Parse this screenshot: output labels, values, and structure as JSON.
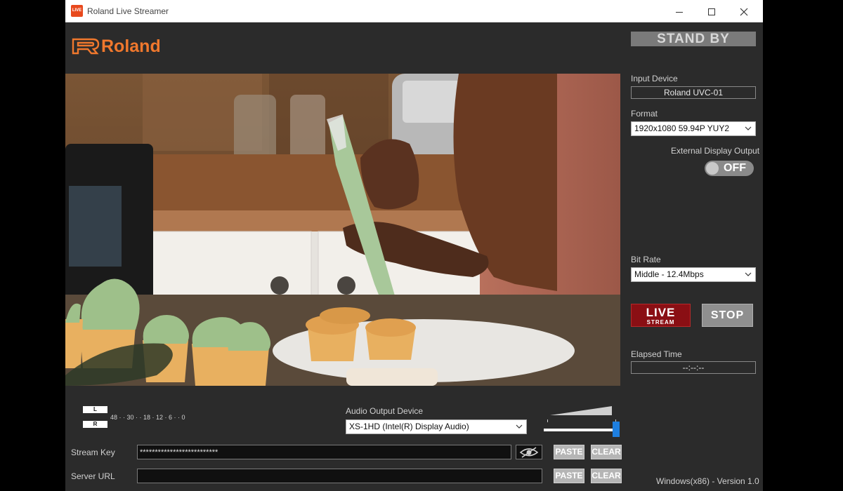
{
  "window": {
    "title": "Roland Live Streamer",
    "app_icon_text": "LIVE",
    "logo_text": "Roland"
  },
  "status": {
    "state_label": "STAND BY"
  },
  "settings": {
    "input_device_label": "Input Device",
    "input_device_value": "Roland UVC-01",
    "format_label": "Format",
    "format_value": "1920x1080 59.94P YUY2",
    "external_display_label": "External Display Output",
    "external_display_state": "OFF",
    "bit_rate_label": "Bit Rate",
    "bit_rate_value": "Middle - 12.4Mbps",
    "live_button_line1": "LIVE",
    "live_button_line2": "STREAM",
    "stop_button_label": "STOP",
    "elapsed_time_label": "Elapsed Time",
    "elapsed_time_value": "--:--:--"
  },
  "audio": {
    "meter_left_label": "L",
    "meter_right_label": "R",
    "meter_scale": "48  ·  ·  30  ·  ·  18  ·  12  ·  6  ·  ·  0",
    "output_device_label": "Audio Output Device",
    "output_device_value": "XS-1HD (Intel(R) Display Audio)",
    "volume_level": 1.0
  },
  "stream": {
    "stream_key_label": "Stream Key",
    "stream_key_value": "**************************",
    "server_url_label": "Server URL",
    "server_url_value": "",
    "paste_label": "PASTE",
    "clear_label": "CLEAR"
  },
  "footer": {
    "version_text": "Windows(x86) - Version 1.0"
  },
  "colors": {
    "logo": "#f0782d",
    "live_button": "#8a0f14",
    "volume_thumb": "#1e7fe0",
    "window_bg": "#2b2b2b"
  }
}
